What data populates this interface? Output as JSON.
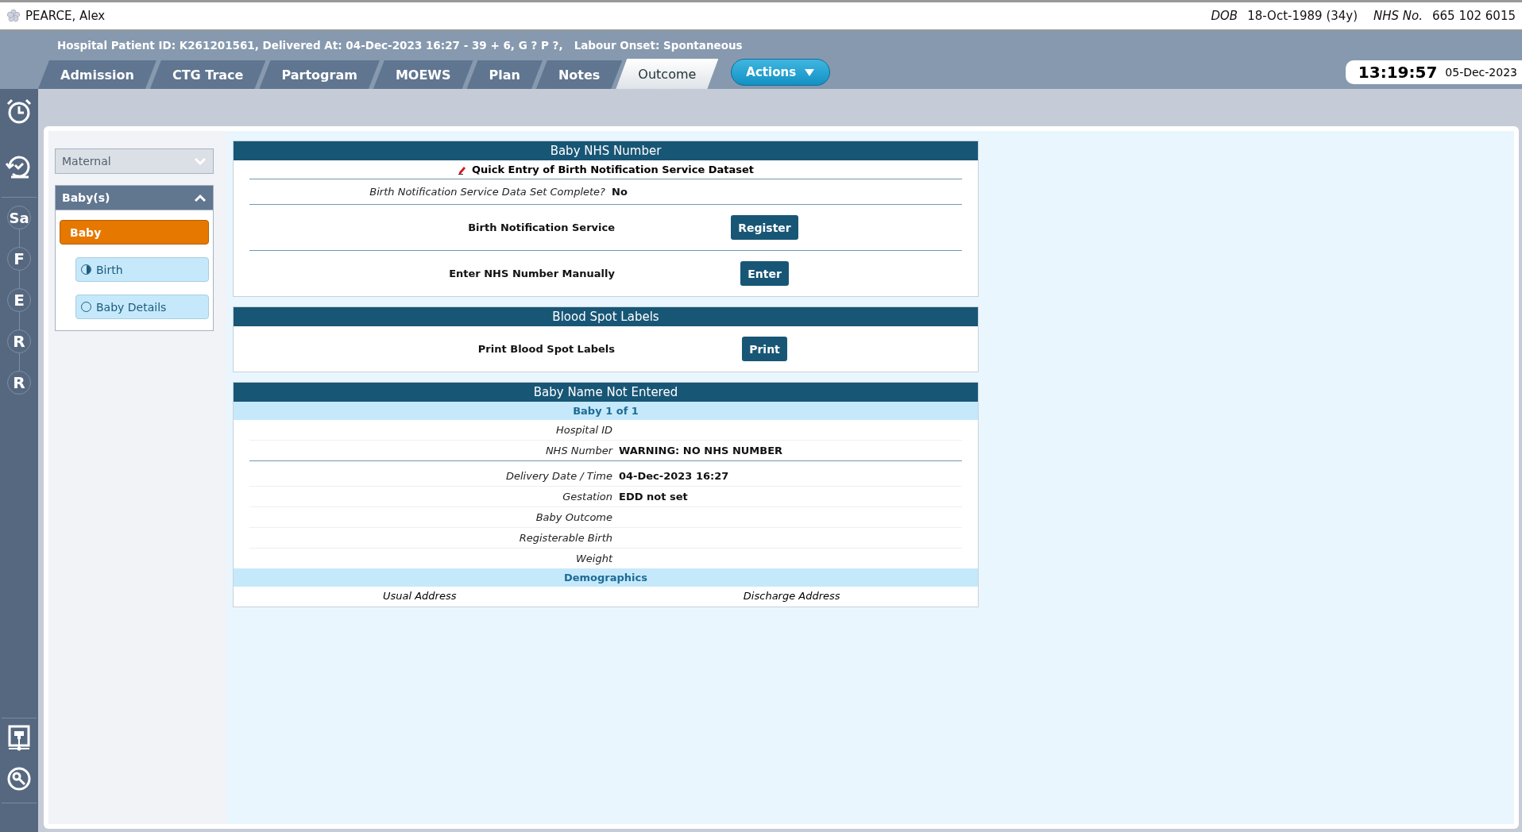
{
  "patient": {
    "name": "PEARCE, Alex",
    "dob_label": "DOB",
    "dob": "18-Oct-1989 (34y)",
    "nhs_label": "NHS No.",
    "nhs": "665 102 6015"
  },
  "info_line": "Hospital Patient ID: K261201561, Delivered At: 04-Dec-2023 16:27 - 39 + 6, G ? P ?,   Labour Onset: Spontaneous",
  "tabs": [
    {
      "label": "Admission",
      "selected": false
    },
    {
      "label": "CTG Trace",
      "selected": false
    },
    {
      "label": "Partogram",
      "selected": false
    },
    {
      "label": "MOEWS",
      "selected": false
    },
    {
      "label": "Plan",
      "selected": false
    },
    {
      "label": "Notes",
      "selected": false
    },
    {
      "label": "Outcome",
      "selected": true
    }
  ],
  "actions_button": "Actions",
  "clock": {
    "time": "13:19:57",
    "date": "05-Dec-2023"
  },
  "rail_letters": [
    "Sa",
    "F",
    "E",
    "R",
    "R"
  ],
  "sidebar": {
    "groups": [
      {
        "label": "Maternal",
        "expanded": false
      },
      {
        "label": "Baby(s)",
        "expanded": true,
        "items": [
          {
            "label": "Baby",
            "kind": "header",
            "selected": true
          },
          {
            "label": "Birth",
            "kind": "step",
            "level": 0.5,
            "selected": false
          },
          {
            "label": "Baby Details",
            "kind": "step",
            "level": 0,
            "selected": false
          }
        ]
      }
    ]
  },
  "nhs_panel": {
    "title": "Baby NHS Number",
    "quick_entry": "Quick Entry of Birth Notification Service Dataset",
    "complete_label": "Birth Notification Service Data Set Complete?",
    "complete_value": "No",
    "actions": [
      {
        "label": "Birth Notification Service",
        "button": "Register"
      },
      {
        "label": "Enter NHS Number Manually",
        "button": "Enter"
      }
    ]
  },
  "blood_panel": {
    "title": "Blood Spot Labels",
    "actions": [
      {
        "label": "Print Blood Spot Labels",
        "button": "Print"
      }
    ]
  },
  "baby_panel": {
    "title": "Baby Name Not Entered",
    "subtitle": "Baby 1 of  1",
    "sections": [
      {
        "rows": [
          {
            "label": "Hospital ID"
          },
          {
            "label": "NHS Number",
            "value": "WARNING: NO NHS NUMBER"
          }
        ]
      },
      {
        "rows": [
          {
            "label": "Delivery Date / Time",
            "value": "04-Dec-2023 16:27"
          },
          {
            "label": "Gestation",
            "value": "EDD not set"
          },
          {
            "label": "Baby Outcome"
          },
          {
            "label": "Registerable Birth"
          },
          {
            "label": "Weight"
          }
        ]
      }
    ],
    "demographics_title": "Demographics",
    "address_columns": [
      "Usual Address",
      "Discharge Address"
    ]
  }
}
